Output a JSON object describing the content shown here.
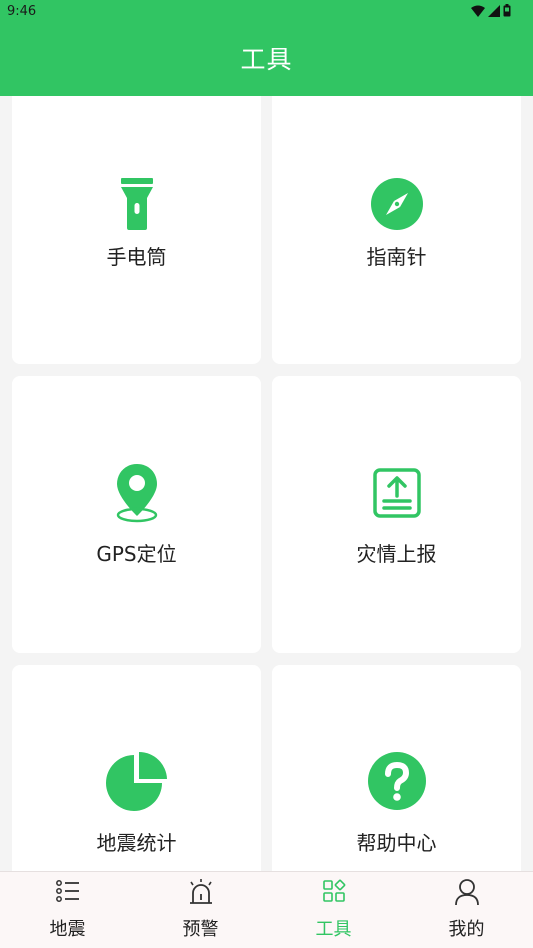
{
  "status_bar": {
    "time": "9:46",
    "icons": [
      "wifi-icon",
      "signal-icon",
      "battery-icon"
    ]
  },
  "header": {
    "title": "工具"
  },
  "colors": {
    "accent": "#31c563",
    "background": "#f4f4f4",
    "card": "#ffffff"
  },
  "tools": [
    {
      "label": "手电筒",
      "icon": "flashlight-icon"
    },
    {
      "label": "指南针",
      "icon": "compass-icon"
    },
    {
      "label": "GPS定位",
      "icon": "location-pin-icon"
    },
    {
      "label": "灾情上报",
      "icon": "upload-report-icon"
    },
    {
      "label": "地震统计",
      "icon": "pie-chart-icon"
    },
    {
      "label": "帮助中心",
      "icon": "help-icon"
    }
  ],
  "tabbar": {
    "active": "工具",
    "tabs": [
      {
        "label": "地震",
        "icon": "list-icon"
      },
      {
        "label": "预警",
        "icon": "alarm-icon"
      },
      {
        "label": "工具",
        "icon": "tools-grid-icon"
      },
      {
        "label": "我的",
        "icon": "user-icon"
      }
    ]
  }
}
